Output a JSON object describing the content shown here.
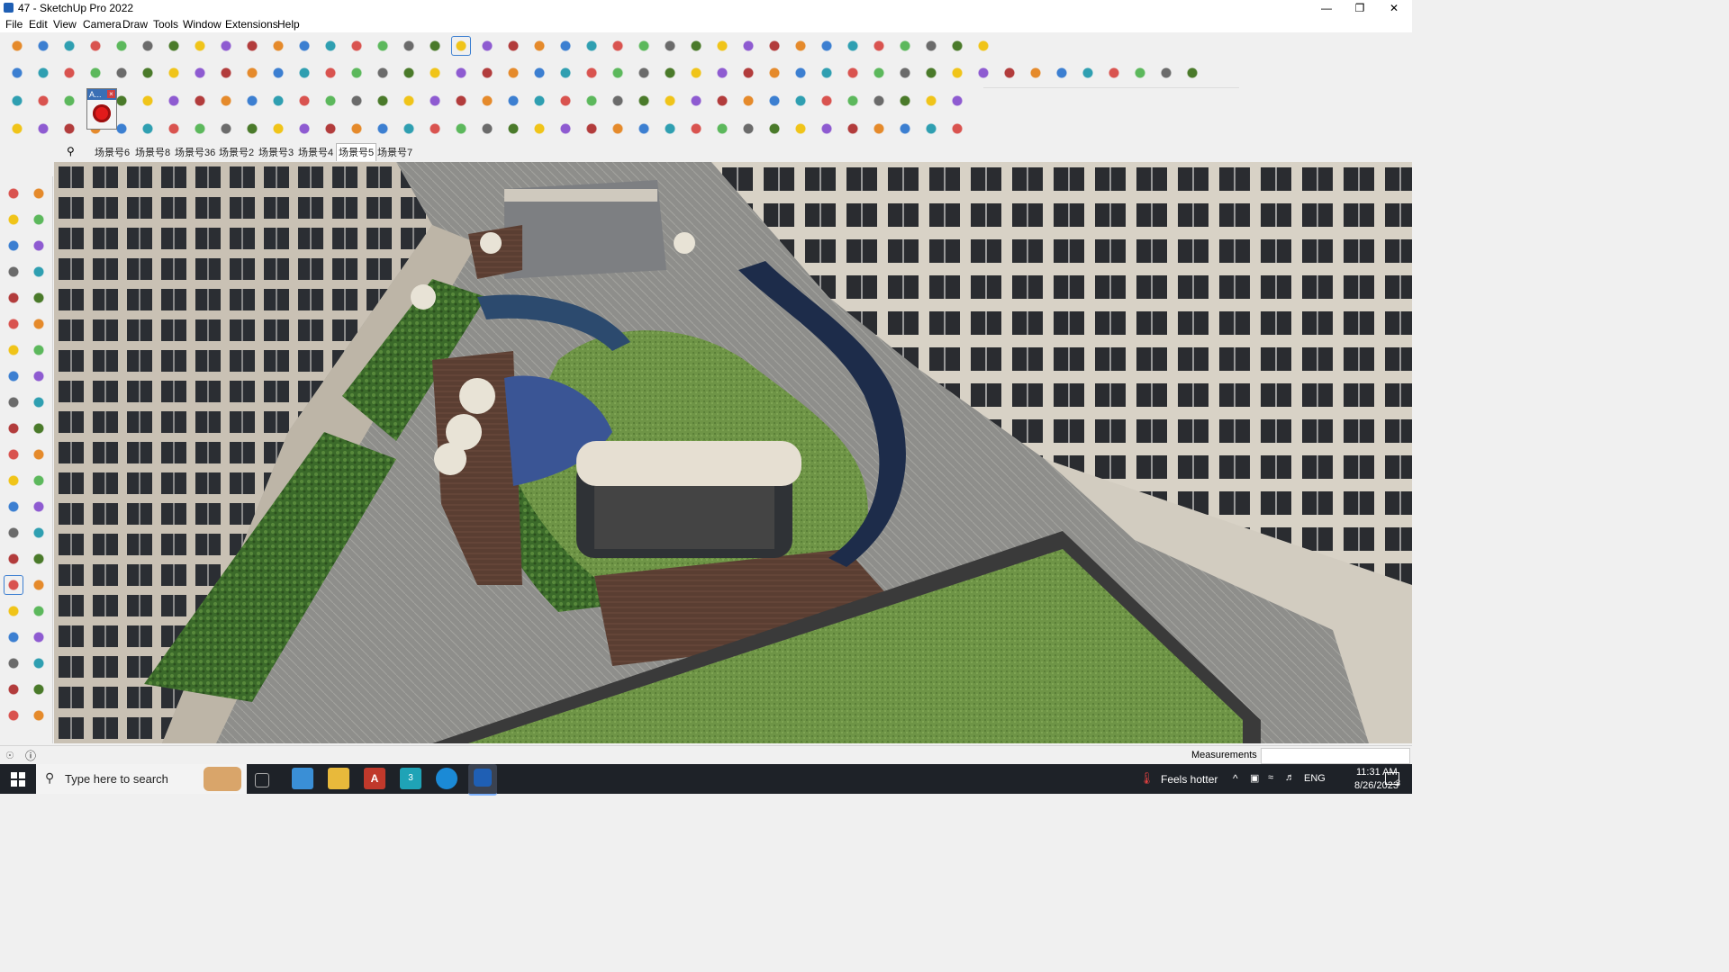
{
  "window": {
    "title": "47 - SketchUp Pro 2022"
  },
  "menu": [
    "File",
    "Edit",
    "View",
    "Camera",
    "Draw",
    "Tools",
    "Window",
    "Extensions",
    "Help"
  ],
  "floating_panel": {
    "label": "A..."
  },
  "scenes": {
    "tabs": [
      "场景号6",
      "场景号8",
      "场景号36",
      "场景号2",
      "场景号3",
      "场景号4",
      "场景号5",
      "场景号7"
    ],
    "active": "场景号5"
  },
  "status": {
    "measurements_label": "Measurements",
    "measurements_value": ""
  },
  "taskbar": {
    "search_placeholder": "Type here to search",
    "weather": "Feels hotter",
    "language": "ENG",
    "time": "11:31 AM",
    "date": "8/26/2023",
    "notification_count": "3"
  },
  "icons": {
    "window_controls": [
      "minimize-icon",
      "maximize-icon",
      "close-icon"
    ],
    "toolbar": [
      "select-icon",
      "eraser-icon",
      "pencil-icon",
      "orbit-icon",
      "pan-icon",
      "zoom-icon",
      "move-icon",
      "rotate-icon",
      "scale-icon",
      "push-pull-icon"
    ]
  },
  "colors": {
    "accent": "#3c7fd1",
    "taskbar": "#1e2228",
    "grass": "#5f8a3a",
    "paving": "#8f8f8c",
    "water": "#1d2c4a",
    "deck": "#5b3f33"
  }
}
